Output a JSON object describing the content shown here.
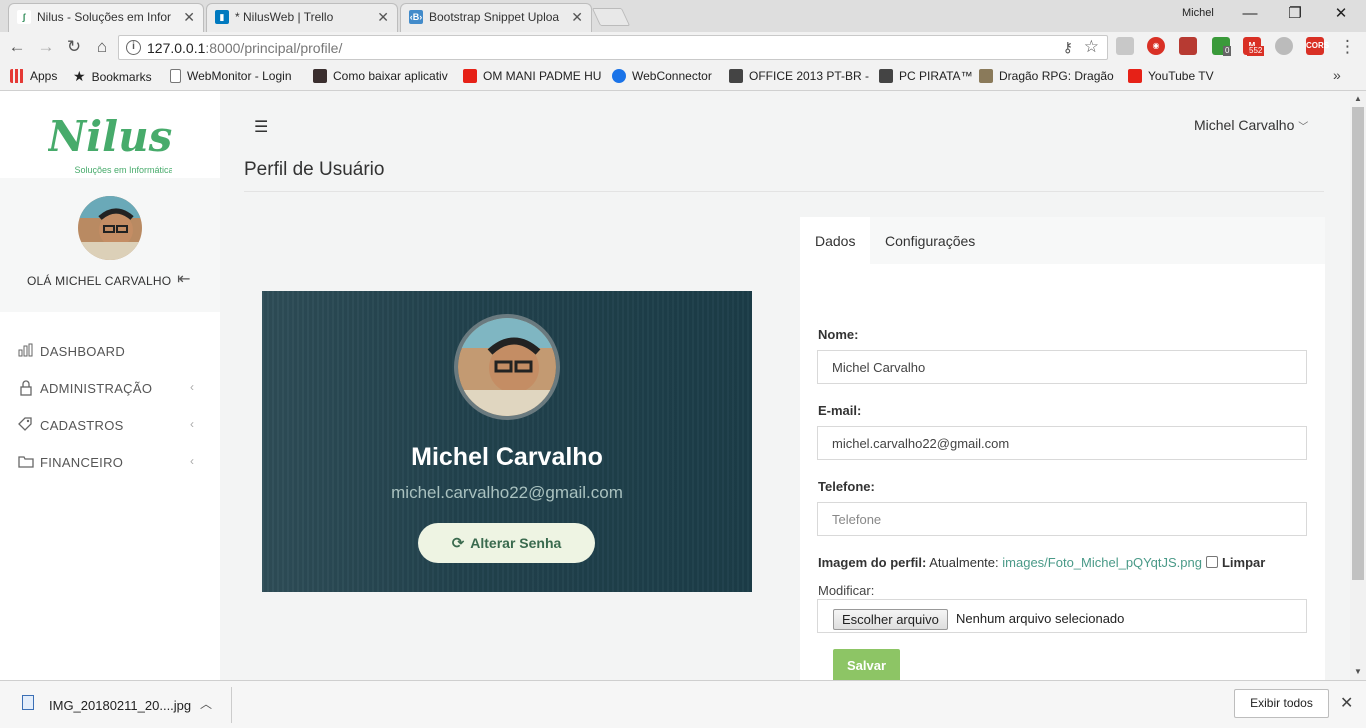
{
  "browser": {
    "tabs": [
      {
        "title": "Nilus - Soluções em Infor",
        "favicon": "nilus-favicon",
        "active": true
      },
      {
        "title": "* NilusWeb | Trello",
        "favicon": "trello-favicon",
        "active": false
      },
      {
        "title": "Bootstrap Snippet Uploa",
        "favicon": "bootsnipp-favicon",
        "active": false
      }
    ],
    "window_user": "Michel",
    "url_host": "127.0.0.1",
    "url_path": ":8000/principal/profile/",
    "extensions": {
      "counter_badge": "0",
      "gmail_badge": "552",
      "cors_label": "CORS"
    },
    "bookmarks": [
      {
        "label": "Apps",
        "icon": "apps-icon"
      },
      {
        "label": "Bookmarks",
        "icon": "star-icon"
      },
      {
        "label": "WebMonitor - Login",
        "icon": "page-icon"
      },
      {
        "label": "Como baixar aplicativ",
        "icon": "tt-icon"
      },
      {
        "label": "OM MANI PADME HU",
        "icon": "youtube-icon"
      },
      {
        "label": "WebConnector",
        "icon": "teamviewer-icon"
      },
      {
        "label": "OFFICE 2013 PT-BR -",
        "icon": "site-icon"
      },
      {
        "label": "PC PIRATA™",
        "icon": "site-icon"
      },
      {
        "label": "Dragão RPG: Dragão",
        "icon": "dragon-icon"
      },
      {
        "label": "YouTube TV",
        "icon": "youtube-icon"
      }
    ],
    "more": "»"
  },
  "sidebar": {
    "logo_text": "Nilus",
    "logo_tagline": "Soluções em Informática",
    "greeting": "OLÁ MICHEL CARVALHO",
    "menu": [
      {
        "label": "DASHBOARD",
        "icon": "bar-chart-icon",
        "has_submenu": false
      },
      {
        "label": "ADMINISTRAÇÃO",
        "icon": "lock-icon",
        "has_submenu": true
      },
      {
        "label": "CADASTROS",
        "icon": "tags-icon",
        "has_submenu": true
      },
      {
        "label": "FINANCEIRO",
        "icon": "folder-icon",
        "has_submenu": true
      }
    ]
  },
  "topbar": {
    "user_name": "Michel Carvalho"
  },
  "page": {
    "title": "Perfil de Usuário"
  },
  "profile_card": {
    "name": "Michel Carvalho",
    "email": "michel.carvalho22@gmail.com",
    "change_password_label": "Alterar Senha"
  },
  "form": {
    "tabs": [
      {
        "label": "Dados",
        "active": true
      },
      {
        "label": "Configurações",
        "active": false
      }
    ],
    "name_label": "Nome:",
    "name_value": "Michel Carvalho",
    "email_label": "E-mail:",
    "email_value": "michel.carvalho22@gmail.com",
    "phone_label": "Telefone:",
    "phone_placeholder": "Telefone",
    "image_label": "Imagem do perfil:",
    "image_current_prefix": "Atualmente:",
    "image_current_link": "images/Foto_Michel_pQYqtJS.png",
    "clear_label": "Limpar",
    "modify_label": "Modificar:",
    "file_button": "Escolher arquivo",
    "file_status": "Nenhum arquivo selecionado",
    "save_label": "Salvar"
  },
  "downloads": {
    "file_name": "IMG_20180211_20....jpg",
    "show_all": "Exibir todos"
  },
  "colors": {
    "accent_green": "#8dc565",
    "card_bg": "#22434e",
    "link": "#4a9a88"
  }
}
